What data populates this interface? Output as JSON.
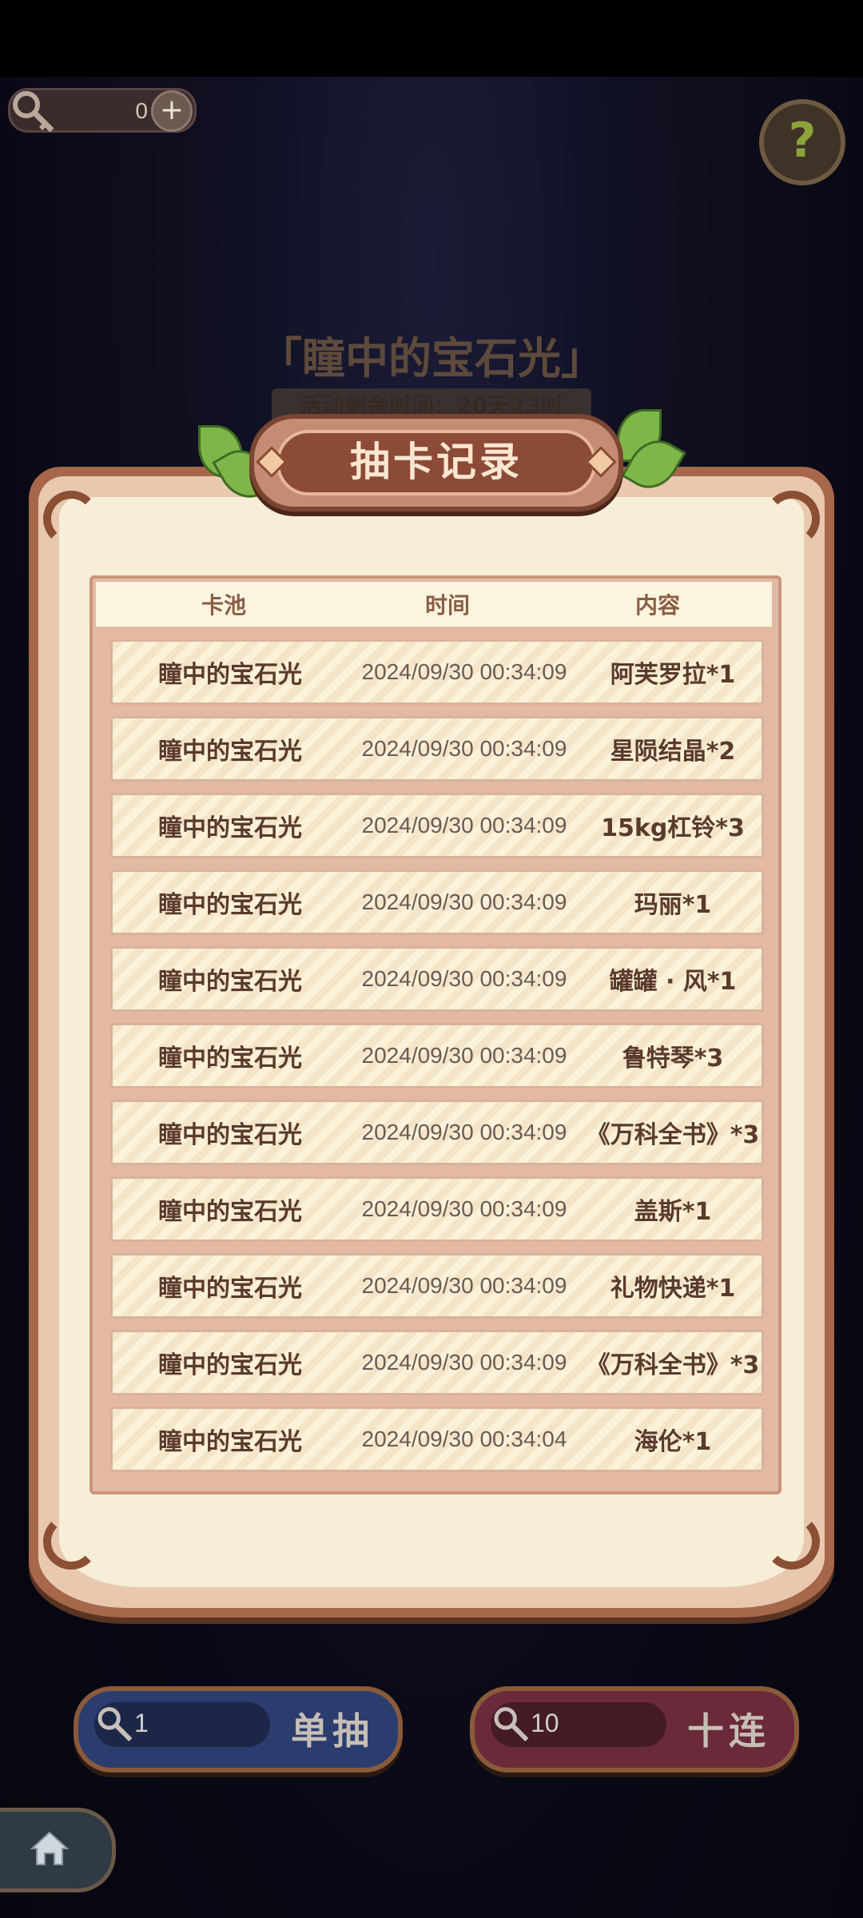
{
  "hud": {
    "key_count": "0",
    "plus_label": "+",
    "help_label": "?"
  },
  "event": {
    "title": "「瞳中的宝石光」",
    "remaining_time": "活动剩余时间：20天23时"
  },
  "panel": {
    "title": "抽卡记录"
  },
  "table": {
    "headers": [
      "卡池",
      "时间",
      "内容"
    ],
    "rows": [
      {
        "pool": "瞳中的宝石光",
        "time": "2024/09/30 00:34:09",
        "content": "阿芙罗拉*1"
      },
      {
        "pool": "瞳中的宝石光",
        "time": "2024/09/30 00:34:09",
        "content": "星陨结晶*2"
      },
      {
        "pool": "瞳中的宝石光",
        "time": "2024/09/30 00:34:09",
        "content": "15kg杠铃*3"
      },
      {
        "pool": "瞳中的宝石光",
        "time": "2024/09/30 00:34:09",
        "content": "玛丽*1"
      },
      {
        "pool": "瞳中的宝石光",
        "time": "2024/09/30 00:34:09",
        "content": "罐罐 · 风*1"
      },
      {
        "pool": "瞳中的宝石光",
        "time": "2024/09/30 00:34:09",
        "content": "鲁特琴*3"
      },
      {
        "pool": "瞳中的宝石光",
        "time": "2024/09/30 00:34:09",
        "content": "《万科全书》*3"
      },
      {
        "pool": "瞳中的宝石光",
        "time": "2024/09/30 00:34:09",
        "content": "盖斯*1"
      },
      {
        "pool": "瞳中的宝石光",
        "time": "2024/09/30 00:34:09",
        "content": "礼物快递*1"
      },
      {
        "pool": "瞳中的宝石光",
        "time": "2024/09/30 00:34:09",
        "content": "《万科全书》*3"
      },
      {
        "pool": "瞳中的宝石光",
        "time": "2024/09/30 00:34:04",
        "content": "海伦*1"
      }
    ]
  },
  "buttons": {
    "single": {
      "count": "1",
      "label": "单抽"
    },
    "ten": {
      "count": "10",
      "label": "十连"
    }
  },
  "icons": {
    "key": "key-icon",
    "help": "help-icon",
    "home": "home-icon"
  },
  "colors": {
    "panel_frame": "#a7674a",
    "panel_paper": "#f7eed8",
    "banner": "#8b4b36",
    "single_button": "#2b3d6f",
    "ten_button": "#6a2a3a"
  }
}
